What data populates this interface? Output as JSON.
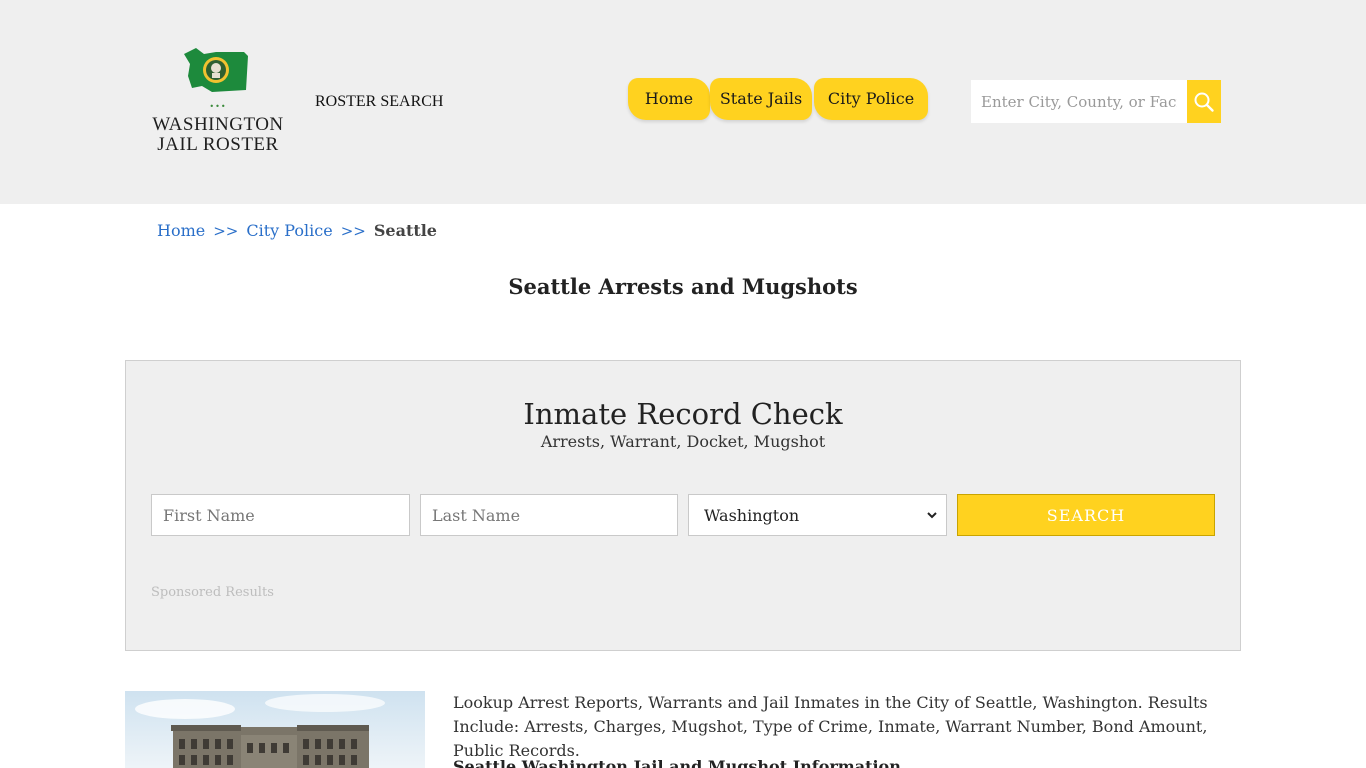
{
  "header": {
    "logo_line1": "WASHINGTON",
    "logo_line2": "JAIL ROSTER",
    "logo_dots": "•••",
    "roster_search": "ROSTER SEARCH",
    "nav": [
      {
        "label": "Home"
      },
      {
        "label": "State Jails"
      },
      {
        "label": "City Police"
      }
    ],
    "search_placeholder": "Enter City, County, or Facil",
    "accent_color": "#ffd21f"
  },
  "breadcrumb": {
    "home": "Home",
    "sep": ">>",
    "city_police": "City Police",
    "current": "Seattle"
  },
  "page_title": "Seattle Arrests and Mugshots",
  "record_check": {
    "title": "Inmate Record Check",
    "subtitle": "Arrests, Warrant, Docket, Mugshot",
    "first_name_placeholder": "First Name",
    "last_name_placeholder": "Last Name",
    "state_value": "Washington",
    "search_label": "SEARCH",
    "sponsored": "Sponsored Results"
  },
  "intro_text": "Lookup Arrest Reports, Warrants and Jail Inmates in the City of Seattle, Washington. Results Include: Arrests, Charges, Mugshot, Type of Crime, Inmate, Warrant Number, Bond Amount, Public Records.",
  "subhead": "Seattle Washington Jail and Mugshot Information"
}
